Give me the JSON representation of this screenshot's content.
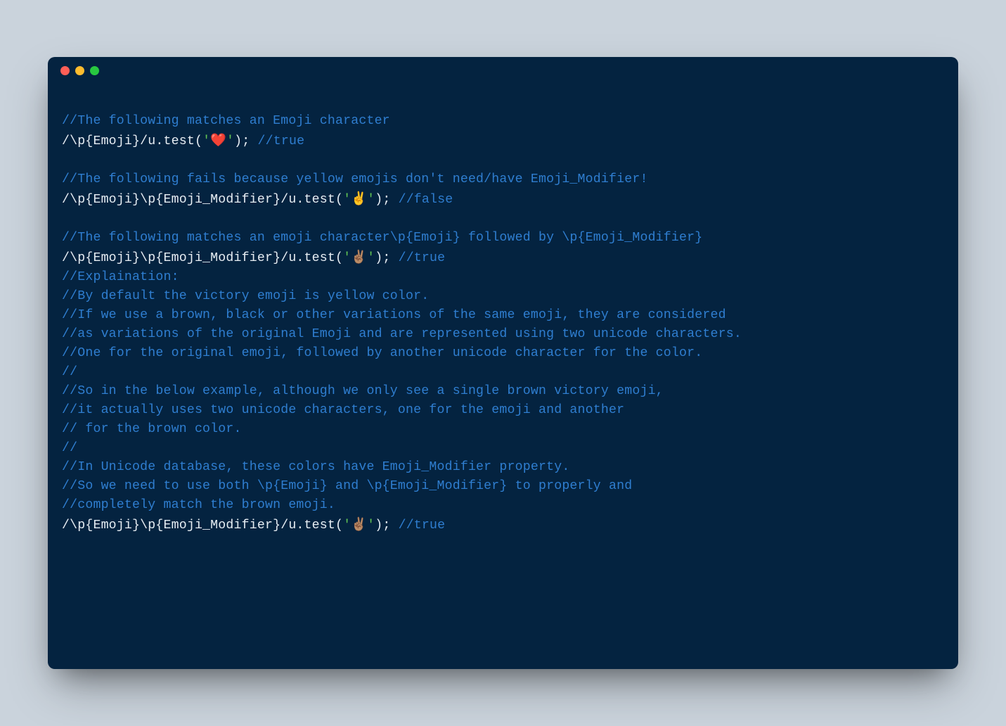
{
  "lines": [
    {
      "segments": [
        {
          "cls": "c",
          "text": "//The following matches an Emoji character"
        }
      ]
    },
    {
      "segments": [
        {
          "cls": "w",
          "text": "/\\p{Emoji}/u.test("
        },
        {
          "cls": "s",
          "text": "'"
        },
        {
          "cls": "emoji",
          "text": "❤️"
        },
        {
          "cls": "s",
          "text": "'"
        },
        {
          "cls": "w",
          "text": "); "
        },
        {
          "cls": "c",
          "text": "//true"
        }
      ]
    },
    {
      "segments": [
        {
          "cls": "w",
          "text": " "
        }
      ]
    },
    {
      "segments": [
        {
          "cls": "c",
          "text": "//The following fails because yellow emojis don't need/have Emoji_Modifier!"
        }
      ]
    },
    {
      "segments": [
        {
          "cls": "w",
          "text": "/\\p{Emoji}\\p{Emoji_Modifier}/u.test("
        },
        {
          "cls": "s",
          "text": "'"
        },
        {
          "cls": "emoji",
          "text": "✌️"
        },
        {
          "cls": "s",
          "text": "'"
        },
        {
          "cls": "w",
          "text": "); "
        },
        {
          "cls": "c",
          "text": "//false"
        }
      ]
    },
    {
      "segments": [
        {
          "cls": "w",
          "text": " "
        }
      ]
    },
    {
      "segments": [
        {
          "cls": "c",
          "text": "//The following matches an emoji character\\p{Emoji} followed by \\p{Emoji_Modifier}"
        }
      ]
    },
    {
      "segments": [
        {
          "cls": "w",
          "text": "/\\p{Emoji}\\p{Emoji_Modifier}/u.test("
        },
        {
          "cls": "s",
          "text": "'"
        },
        {
          "cls": "emoji",
          "text": "✌🏽"
        },
        {
          "cls": "s",
          "text": "'"
        },
        {
          "cls": "w",
          "text": "); "
        },
        {
          "cls": "c",
          "text": "//true"
        }
      ]
    },
    {
      "segments": [
        {
          "cls": "c",
          "text": "//Explaination:"
        }
      ]
    },
    {
      "segments": [
        {
          "cls": "c",
          "text": "//By default the victory emoji is yellow color."
        }
      ]
    },
    {
      "segments": [
        {
          "cls": "c",
          "text": "//If we use a brown, black or other variations of the same emoji, they are considered"
        }
      ]
    },
    {
      "segments": [
        {
          "cls": "c",
          "text": "//as variations of the original Emoji and are represented using two unicode characters."
        }
      ]
    },
    {
      "segments": [
        {
          "cls": "c",
          "text": "//One for the original emoji, followed by another unicode character for the color."
        }
      ]
    },
    {
      "segments": [
        {
          "cls": "c",
          "text": "//"
        }
      ]
    },
    {
      "segments": [
        {
          "cls": "c",
          "text": "//So in the below example, although we only see a single brown victory emoji,"
        }
      ]
    },
    {
      "segments": [
        {
          "cls": "c",
          "text": "//it actually uses two unicode characters, one for the emoji and another"
        }
      ]
    },
    {
      "segments": [
        {
          "cls": "c",
          "text": "// for the brown color."
        }
      ]
    },
    {
      "segments": [
        {
          "cls": "c",
          "text": "//"
        }
      ]
    },
    {
      "segments": [
        {
          "cls": "c",
          "text": "//In Unicode database, these colors have Emoji_Modifier property."
        }
      ]
    },
    {
      "segments": [
        {
          "cls": "c",
          "text": "//So we need to use both \\p{Emoji} and \\p{Emoji_Modifier} to properly and"
        }
      ]
    },
    {
      "segments": [
        {
          "cls": "c",
          "text": "//completely match the brown emoji."
        }
      ]
    },
    {
      "segments": [
        {
          "cls": "w",
          "text": "/\\p{Emoji}\\p{Emoji_Modifier}/u.test("
        },
        {
          "cls": "s",
          "text": "'"
        },
        {
          "cls": "emoji",
          "text": "✌🏽"
        },
        {
          "cls": "s",
          "text": "'"
        },
        {
          "cls": "w",
          "text": "); "
        },
        {
          "cls": "c",
          "text": "//true"
        }
      ]
    }
  ]
}
